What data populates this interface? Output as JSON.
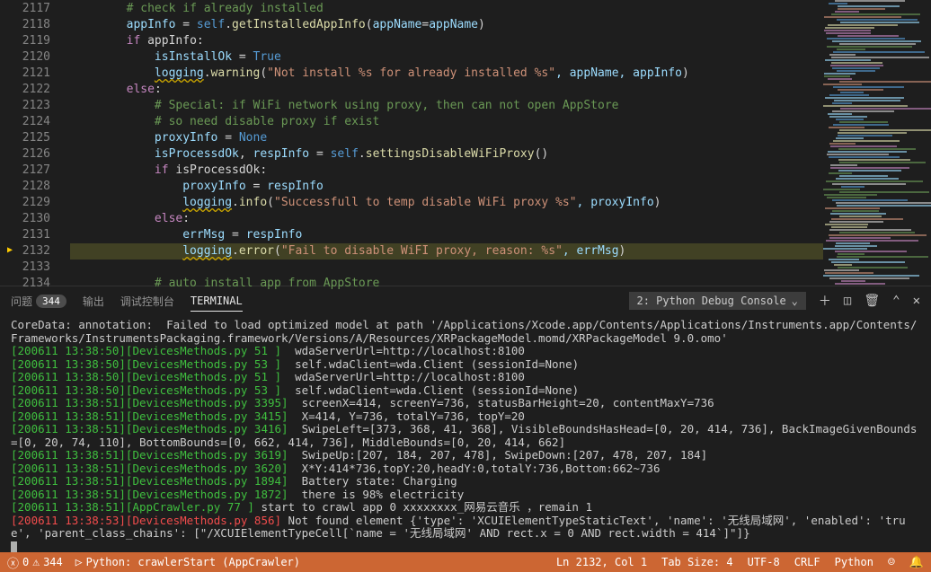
{
  "code": {
    "lines": [
      {
        "num": "2117",
        "indent": "        ",
        "segs": [
          {
            "t": "# check if already installed",
            "cls": "c-comment"
          }
        ]
      },
      {
        "num": "2118",
        "indent": "        ",
        "segs": [
          {
            "t": "appInfo",
            "cls": "c-var"
          },
          {
            "t": " = ",
            "cls": "c-punct"
          },
          {
            "t": "self",
            "cls": "c-const"
          },
          {
            "t": ".",
            "cls": "c-punct"
          },
          {
            "t": "getInstalledAppInfo",
            "cls": "c-method"
          },
          {
            "t": "(",
            "cls": "c-punct"
          },
          {
            "t": "appName",
            "cls": "c-param"
          },
          {
            "t": "=",
            "cls": "c-punct"
          },
          {
            "t": "appName",
            "cls": "c-var"
          },
          {
            "t": ")",
            "cls": "c-punct"
          }
        ]
      },
      {
        "num": "2119",
        "indent": "        ",
        "segs": [
          {
            "t": "if",
            "cls": "c-keyword"
          },
          {
            "t": " appInfo:",
            "cls": "c-punct"
          }
        ]
      },
      {
        "num": "2120",
        "indent": "            ",
        "segs": [
          {
            "t": "isInstallOk",
            "cls": "c-var"
          },
          {
            "t": " = ",
            "cls": "c-punct"
          },
          {
            "t": "True",
            "cls": "c-const"
          }
        ]
      },
      {
        "num": "2121",
        "indent": "            ",
        "segs": [
          {
            "t": "logging",
            "cls": "c-var c-warn"
          },
          {
            "t": ".",
            "cls": "c-punct"
          },
          {
            "t": "warning",
            "cls": "c-method"
          },
          {
            "t": "(",
            "cls": "c-punct"
          },
          {
            "t": "\"Not install %s for already installed %s\"",
            "cls": "c-string"
          },
          {
            "t": ", appName, appInfo",
            "cls": "c-var"
          },
          {
            "t": ")",
            "cls": "c-punct"
          }
        ]
      },
      {
        "num": "2122",
        "indent": "        ",
        "segs": [
          {
            "t": "else",
            "cls": "c-keyword"
          },
          {
            "t": ":",
            "cls": "c-punct"
          }
        ]
      },
      {
        "num": "2123",
        "indent": "            ",
        "segs": [
          {
            "t": "# Special: if WiFi network using proxy, then can not open AppStore",
            "cls": "c-comment"
          }
        ]
      },
      {
        "num": "2124",
        "indent": "            ",
        "segs": [
          {
            "t": "# so need disable proxy if exist",
            "cls": "c-comment"
          }
        ]
      },
      {
        "num": "2125",
        "indent": "            ",
        "segs": [
          {
            "t": "proxyInfo",
            "cls": "c-var"
          },
          {
            "t": " = ",
            "cls": "c-punct"
          },
          {
            "t": "None",
            "cls": "c-const"
          }
        ]
      },
      {
        "num": "2126",
        "indent": "            ",
        "segs": [
          {
            "t": "isProcessdOk",
            "cls": "c-var"
          },
          {
            "t": ", ",
            "cls": "c-punct"
          },
          {
            "t": "respInfo",
            "cls": "c-var"
          },
          {
            "t": " = ",
            "cls": "c-punct"
          },
          {
            "t": "self",
            "cls": "c-const"
          },
          {
            "t": ".",
            "cls": "c-punct"
          },
          {
            "t": "settingsDisableWiFiProxy",
            "cls": "c-method"
          },
          {
            "t": "()",
            "cls": "c-punct"
          }
        ]
      },
      {
        "num": "2127",
        "indent": "            ",
        "segs": [
          {
            "t": "if",
            "cls": "c-keyword"
          },
          {
            "t": " isProcessdOk:",
            "cls": "c-punct"
          }
        ]
      },
      {
        "num": "2128",
        "indent": "                ",
        "segs": [
          {
            "t": "proxyInfo",
            "cls": "c-var"
          },
          {
            "t": " = ",
            "cls": "c-punct"
          },
          {
            "t": "respInfo",
            "cls": "c-var"
          }
        ]
      },
      {
        "num": "2129",
        "indent": "                ",
        "segs": [
          {
            "t": "logging",
            "cls": "c-var c-warn"
          },
          {
            "t": ".",
            "cls": "c-punct"
          },
          {
            "t": "info",
            "cls": "c-method"
          },
          {
            "t": "(",
            "cls": "c-punct"
          },
          {
            "t": "\"Successfull to temp disable WiFi proxy %s\"",
            "cls": "c-string"
          },
          {
            "t": ", proxyInfo",
            "cls": "c-var"
          },
          {
            "t": ")",
            "cls": "c-punct"
          }
        ]
      },
      {
        "num": "2130",
        "indent": "            ",
        "segs": [
          {
            "t": "else",
            "cls": "c-keyword"
          },
          {
            "t": ":",
            "cls": "c-punct"
          }
        ]
      },
      {
        "num": "2131",
        "indent": "                ",
        "segs": [
          {
            "t": "errMsg",
            "cls": "c-var"
          },
          {
            "t": " = ",
            "cls": "c-punct"
          },
          {
            "t": "respInfo",
            "cls": "c-var"
          }
        ]
      },
      {
        "num": "2132",
        "indent": "                ",
        "hl": true,
        "arrow": true,
        "segs": [
          {
            "t": "logging",
            "cls": "c-var c-warn"
          },
          {
            "t": ".",
            "cls": "c-punct"
          },
          {
            "t": "error",
            "cls": "c-method"
          },
          {
            "t": "(",
            "cls": "c-punct"
          },
          {
            "t": "\"Fail to disable WiFI proxy, reason: %s\"",
            "cls": "c-string"
          },
          {
            "t": ", errMsg",
            "cls": "c-var"
          },
          {
            "t": ")",
            "cls": "c-punct"
          }
        ]
      },
      {
        "num": "2133",
        "indent": "",
        "segs": []
      },
      {
        "num": "2134",
        "indent": "            ",
        "segs": [
          {
            "t": "# auto install app from AppStore",
            "cls": "c-comment"
          }
        ]
      }
    ]
  },
  "panel": {
    "tabs": {
      "problems": "问题",
      "problems_badge": "344",
      "output": "输出",
      "debug": "调试控制台",
      "terminal": "TERMINAL"
    },
    "dropdown": "2: Python Debug Console"
  },
  "terminal": {
    "lines": [
      {
        "cls": "t-white",
        "t": "CoreData: annotation:  Failed to load optimized model at path '/Applications/Xcode.app/Contents/Applications/Instruments.app/Contents/Frameworks/InstrumentsPackaging.framework/Versions/A/Resources/XRPackageModel.momd/XRPackageModel 9.0.omo'"
      },
      {
        "spans": [
          {
            "cls": "t-green",
            "t": "[200611 13:38:50][DevicesMethods.py 51 ]"
          },
          {
            "cls": "t-white",
            "t": "  wdaServerUrl=http://localhost:8100"
          }
        ]
      },
      {
        "spans": [
          {
            "cls": "t-green",
            "t": "[200611 13:38:50][DevicesMethods.py 53 ]"
          },
          {
            "cls": "t-white",
            "t": "  self.wdaClient=wda.Client (sessionId=None)"
          }
        ]
      },
      {
        "spans": [
          {
            "cls": "t-green",
            "t": "[200611 13:38:50][DevicesMethods.py 51 ]"
          },
          {
            "cls": "t-white",
            "t": "  wdaServerUrl=http://localhost:8100"
          }
        ]
      },
      {
        "spans": [
          {
            "cls": "t-green",
            "t": "[200611 13:38:50][DevicesMethods.py 53 ]"
          },
          {
            "cls": "t-white",
            "t": "  self.wdaClient=wda.Client (sessionId=None)"
          }
        ]
      },
      {
        "spans": [
          {
            "cls": "t-green",
            "t": "[200611 13:38:51][DevicesMethods.py 3395]"
          },
          {
            "cls": "t-white",
            "t": "  screenX=414, screenY=736, statusBarHeight=20, contentMaxY=736"
          }
        ]
      },
      {
        "spans": [
          {
            "cls": "t-green",
            "t": "[200611 13:38:51][DevicesMethods.py 3415]"
          },
          {
            "cls": "t-white",
            "t": "  X=414, Y=736, totalY=736, topY=20"
          }
        ]
      },
      {
        "spans": [
          {
            "cls": "t-green",
            "t": "[200611 13:38:51][DevicesMethods.py 3416]"
          },
          {
            "cls": "t-white",
            "t": "  SwipeLeft=[373, 368, 41, 368], VisibleBoundsHasHead=[0, 20, 414, 736], BackImageGivenBounds=[0, 20, 74, 110], BottomBounds=[0, 662, 414, 736], MiddleBounds=[0, 20, 414, 662]"
          }
        ]
      },
      {
        "spans": [
          {
            "cls": "t-green",
            "t": "[200611 13:38:51][DevicesMethods.py 3619]"
          },
          {
            "cls": "t-white",
            "t": "  SwipeUp:[207, 184, 207, 478], SwipeDown:[207, 478, 207, 184]"
          }
        ]
      },
      {
        "spans": [
          {
            "cls": "t-green",
            "t": "[200611 13:38:51][DevicesMethods.py 3620]"
          },
          {
            "cls": "t-white",
            "t": "  X*Y:414*736,topY:20,headY:0,totalY:736,Bottom:662~736"
          }
        ]
      },
      {
        "spans": [
          {
            "cls": "t-green",
            "t": "[200611 13:38:51][DevicesMethods.py 1894]"
          },
          {
            "cls": "t-white",
            "t": "  Battery state: Charging"
          }
        ]
      },
      {
        "spans": [
          {
            "cls": "t-green",
            "t": "[200611 13:38:51][DevicesMethods.py 1872]"
          },
          {
            "cls": "t-white",
            "t": "  there is 98% electricity"
          }
        ]
      },
      {
        "spans": [
          {
            "cls": "t-green",
            "t": "[200611 13:38:51][AppCrawler.py 77 ]"
          },
          {
            "cls": "t-white",
            "t": " start to crawl app 0 xxxxxxxx_网易云音乐 ，remain 1"
          }
        ]
      },
      {
        "spans": [
          {
            "cls": "t-red",
            "t": "[200611 13:38:53][DevicesMethods.py 856]"
          },
          {
            "cls": "t-white",
            "t": " Not found element {'type': 'XCUIElementTypeStaticText', 'name': '无线局域网', 'enabled': 'true', 'parent_class_chains': [\"/XCUIElementTypeCell[`name = '无线局域网' AND rect.x = 0 AND rect.width = 414`]\"]}"
          }
        ]
      }
    ]
  },
  "statusbar": {
    "errors": "0",
    "warnings": "344",
    "debug": "Python: crawlerStart (AppCrawler)",
    "ln_col": "Ln 2132, Col 1",
    "tabsize": "Tab Size: 4",
    "encoding": "UTF-8",
    "eol": "CRLF",
    "lang": "Python"
  }
}
